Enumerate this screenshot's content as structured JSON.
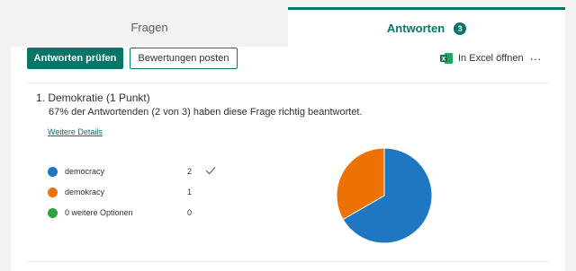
{
  "tabs": [
    {
      "label": "Fragen",
      "active": false
    },
    {
      "label": "Antworten",
      "active": true,
      "badge": "3"
    }
  ],
  "toolbar": {
    "review_label": "Antworten prüfen",
    "post_scores_label": "Bewertungen posten",
    "excel_label": "In Excel öffnen",
    "more_label": "···"
  },
  "question": {
    "title": "1. Demokratie (1 Punkt)",
    "summary": "67% der Antwortenden (2 von 3) haben diese Frage richtig beantwortet.",
    "details_link": "Weitere Details"
  },
  "options": [
    {
      "label": "democracy",
      "count": "2",
      "correct": true,
      "color": "#1f77c4"
    },
    {
      "label": "demokracy",
      "count": "1",
      "correct": false,
      "color": "#ee7203"
    },
    {
      "label": "0 weitere Optionen",
      "count": "0",
      "correct": false,
      "color": "#2ea43a"
    }
  ],
  "colors": {
    "accent": "#077568"
  },
  "chart_data": {
    "type": "pie",
    "labels": [
      "democracy",
      "demokracy",
      "0 weitere Optionen"
    ],
    "values": [
      2,
      1,
      0
    ],
    "colors": [
      "#1f77c4",
      "#ee7203",
      "#2ea43a"
    ]
  }
}
